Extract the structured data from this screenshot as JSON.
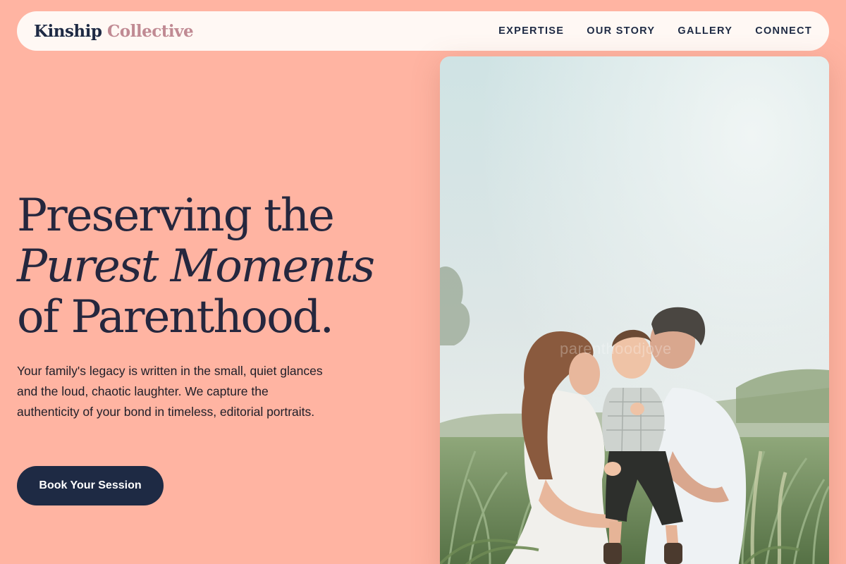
{
  "brand": {
    "name_primary": "Kinship",
    "name_accent": "Collective"
  },
  "nav": {
    "links": [
      {
        "label": "EXPERTISE"
      },
      {
        "label": "OUR STORY"
      },
      {
        "label": "GALLERY"
      },
      {
        "label": "CONNECT"
      }
    ]
  },
  "hero": {
    "title_line1": "Preserving the",
    "title_line2": "Purest Moments",
    "title_line3": "of Parenthood.",
    "description": "Your family's legacy is written in the small, quiet glances and the loud, chaotic laughter. We capture the authenticity of your bond in timeless, editorial portraits.",
    "cta_label": "Book Your Session"
  },
  "photo": {
    "watermark": "parenthoodjoye"
  },
  "colors": {
    "background": "#FFB4A2",
    "nav_bg": "#FFF8F4",
    "navy": "#1E2A44",
    "accent_mauve": "#C08A93"
  }
}
